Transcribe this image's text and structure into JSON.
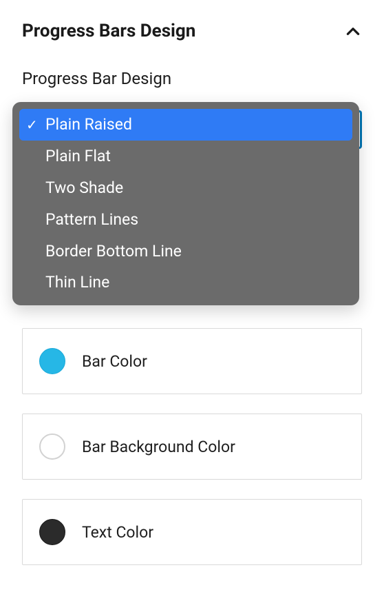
{
  "panel": {
    "title": "Progress Bars Design"
  },
  "design_select": {
    "label": "Progress Bar Design",
    "options": [
      "Plain Raised",
      "Plain Flat",
      "Two Shade",
      "Pattern Lines",
      "Border Bottom Line",
      "Thin Line"
    ],
    "selected_index": 0
  },
  "colors": {
    "bar": {
      "label": "Bar Color",
      "hex": "#26b7e6"
    },
    "bg": {
      "label": "Bar Background Color",
      "hex": "#ffffff"
    },
    "text": {
      "label": "Text Color",
      "hex": "#2b2b2b"
    }
  }
}
